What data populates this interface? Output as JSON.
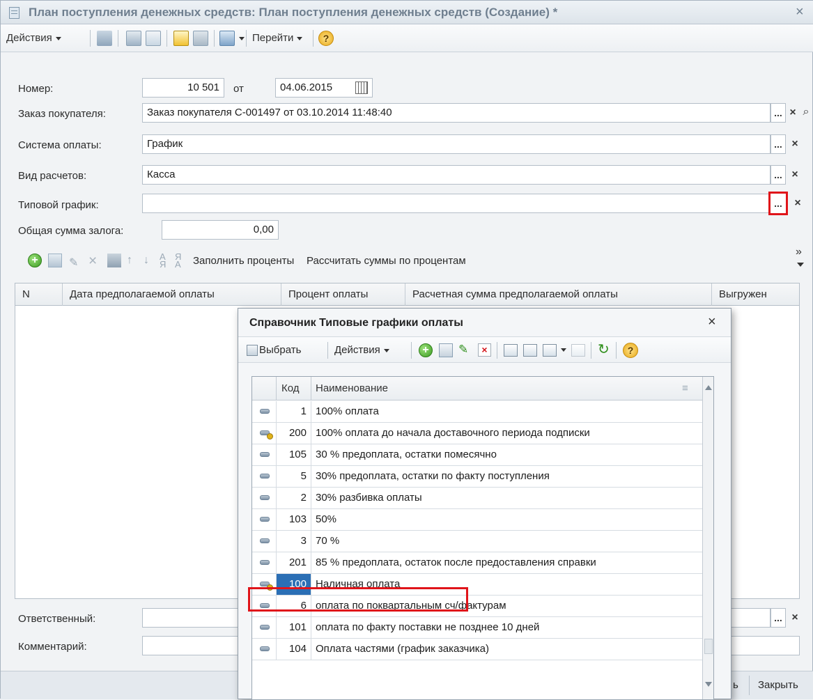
{
  "window": {
    "title": "План поступления денежных средств: План поступления денежных средств (Создание) *",
    "close_glyph": "×"
  },
  "toolbar": {
    "actions_label": "Действия",
    "goto_label": "Перейти",
    "help_glyph": "?"
  },
  "form": {
    "number_label": "Номер:",
    "number_value": "10 501",
    "from_label": "от",
    "date_value": "04.06.2015",
    "order_label": "Заказ покупателя:",
    "order_value": "Заказ покупателя С-001497 от 03.10.2014 11:48:40",
    "payment_system_label": "Система оплаты:",
    "payment_system_value": "График",
    "settlement_label": "Вид расчетов:",
    "settlement_value": "Касса",
    "template_label": "Типовой график:",
    "template_value": "",
    "deposit_label": "Общая сумма залога:",
    "deposit_value": "0,00",
    "responsible_label": "Ответственный:",
    "comment_label": "Комментарий:"
  },
  "table_toolbar": {
    "fill_percents": "Заполнить проценты",
    "calc_sums": "Рассчитать суммы по процентам",
    "more_glyph": "»"
  },
  "grid": {
    "columns": [
      "N",
      "Дата предполагаемой оплаты",
      "Процент оплаты",
      "Расчетная сумма предполагаемой оплаты",
      "Выгружен"
    ]
  },
  "bottom": {
    "partial_button": "ь",
    "close_button": "Закрыть"
  },
  "dialog": {
    "title": "Справочник Типовые графики оплаты",
    "close_glyph": "×",
    "select_label": "Выбрать",
    "actions_label": "Действия",
    "help_glyph": "?",
    "columns": {
      "code": "Код",
      "name": "Наименование"
    },
    "rows": [
      {
        "code": "1",
        "name": "100% оплата",
        "icon": "item-icon"
      },
      {
        "code": "200",
        "name": "100% оплата до начала доставочного периода подписки",
        "icon": "item-marked-icon"
      },
      {
        "code": "105",
        "name": "30 % предоплата, остатки помесячно",
        "icon": "item-icon"
      },
      {
        "code": "5",
        "name": "30% предоплата, остатки по факту поступления",
        "icon": "item-icon"
      },
      {
        "code": "2",
        "name": "30% разбивка оплаты",
        "icon": "item-icon"
      },
      {
        "code": "103",
        "name": "50%",
        "icon": "item-icon"
      },
      {
        "code": "3",
        "name": "70 %",
        "icon": "item-icon"
      },
      {
        "code": "201",
        "name": "85 % предоплата, остаток после предоставления справки",
        "icon": "item-icon"
      },
      {
        "code": "100",
        "name": "Наличная оплата",
        "icon": "item-marked-icon",
        "selected": true
      },
      {
        "code": "6",
        "name": "оплата по поквартальным сч/фактурам",
        "icon": "item-icon"
      },
      {
        "code": "101",
        "name": "оплата по факту поставки не позднее 10 дней",
        "icon": "item-icon"
      },
      {
        "code": "104",
        "name": "Оплата частями (график заказчика)",
        "icon": "item-icon"
      }
    ]
  },
  "colors": {
    "highlight": "#e0141a",
    "selection": "#2b6fb5"
  }
}
